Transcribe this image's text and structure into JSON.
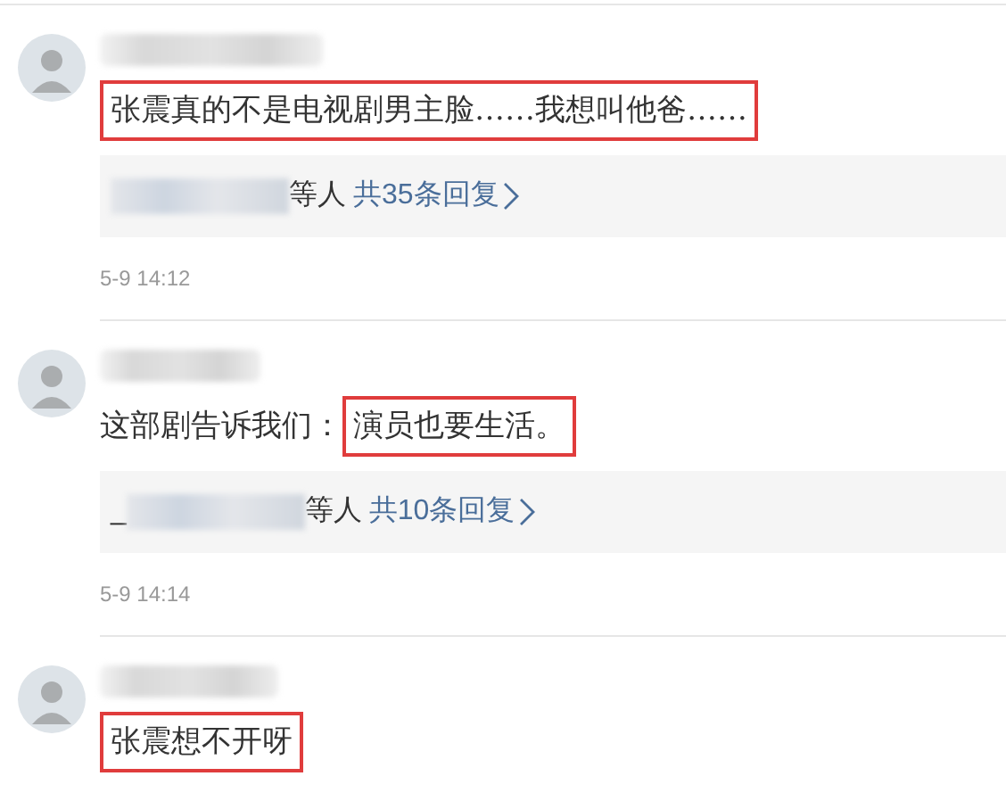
{
  "comments": [
    {
      "text_boxed": "张震真的不是电视剧男主脸……我想叫他爸……",
      "replies": {
        "suffix": "等人",
        "link": "共35条回复"
      },
      "time": "5-9 14:12"
    },
    {
      "text_plain": "这部剧告诉我们：",
      "text_boxed": "演员也要生活。",
      "replies": {
        "prefix": "_",
        "suffix": "等人",
        "link": "共10条回复"
      },
      "time": "5-9 14:14"
    },
    {
      "text_boxed": "张震想不开呀"
    }
  ]
}
